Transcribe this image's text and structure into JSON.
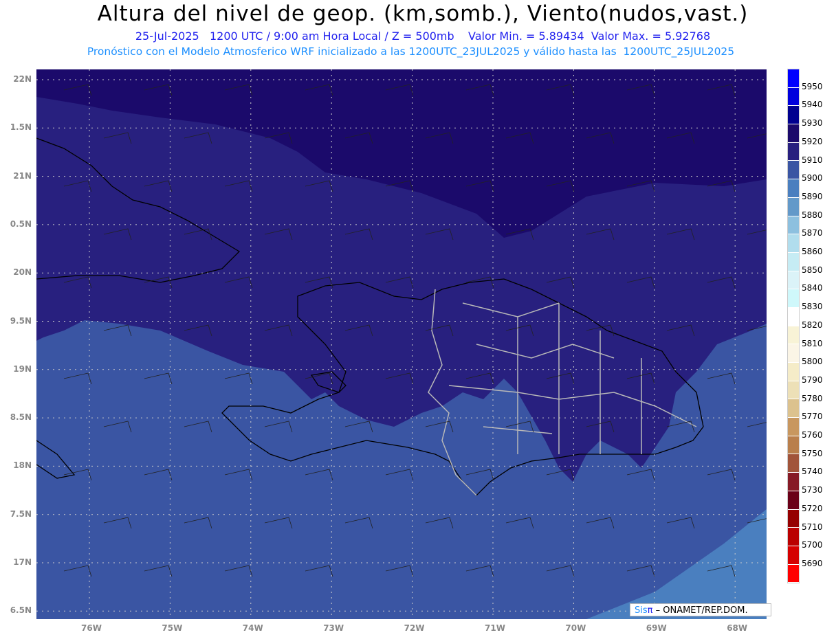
{
  "title": "Altura del nivel de geop. (km,somb.), Viento(nudos,vast.)",
  "subtitle": "25-Jul-2025   1200 UTC / 9:00 am Hora Local / Z = 500mb    Valor Min. = 5.89434  Valor Max. = 5.92768",
  "info": "Pronóstico con el Modelo Atmosferico WRF inicializado a las 1200UTC_23JUL2025 y válido hasta las  1200UTC_25JUL2025",
  "lon_ticks": [
    "76W",
    "75W",
    "74W",
    "73W",
    "72W",
    "71W",
    "70W",
    "69W",
    "68W"
  ],
  "lat_ticks": [
    "22N",
    "1.5N",
    "21N",
    "0.5N",
    "20N",
    "9.5N",
    "19N",
    "8.5N",
    "18N",
    "7.5N",
    "17N",
    "6.5N"
  ],
  "colorbar": {
    "labels": [
      "5950",
      "5940",
      "5930",
      "5920",
      "5910",
      "5900",
      "5890",
      "5880",
      "5870",
      "5860",
      "5850",
      "5840",
      "5830",
      "5820",
      "5810",
      "5800",
      "5790",
      "5780",
      "5770",
      "5760",
      "5750",
      "5740",
      "5730",
      "5720",
      "5710",
      "5700",
      "5690"
    ],
    "colors": [
      "#0000ff",
      "#0000dd",
      "#00008f",
      "#1b0a6b",
      "#28207f",
      "#3a55a3",
      "#4a7fbf",
      "#6399c9",
      "#8dc0df",
      "#b1dded",
      "#c6ecf4",
      "#dbf3f8",
      "#cff8fb",
      "#ffffff",
      "#f8f3d6",
      "#fbf5e6",
      "#f5ecc8",
      "#ede0b7",
      "#dcc28e",
      "#c8975f",
      "#b97f4c",
      "#a1543a",
      "#861a25",
      "#6a0017",
      "#950000",
      "#ba0000",
      "#d50000",
      "#ff0000"
    ]
  },
  "credit": {
    "brand1": "Sis",
    "brand2": "π",
    "text": " – ONAMET/REP.DOM."
  }
}
